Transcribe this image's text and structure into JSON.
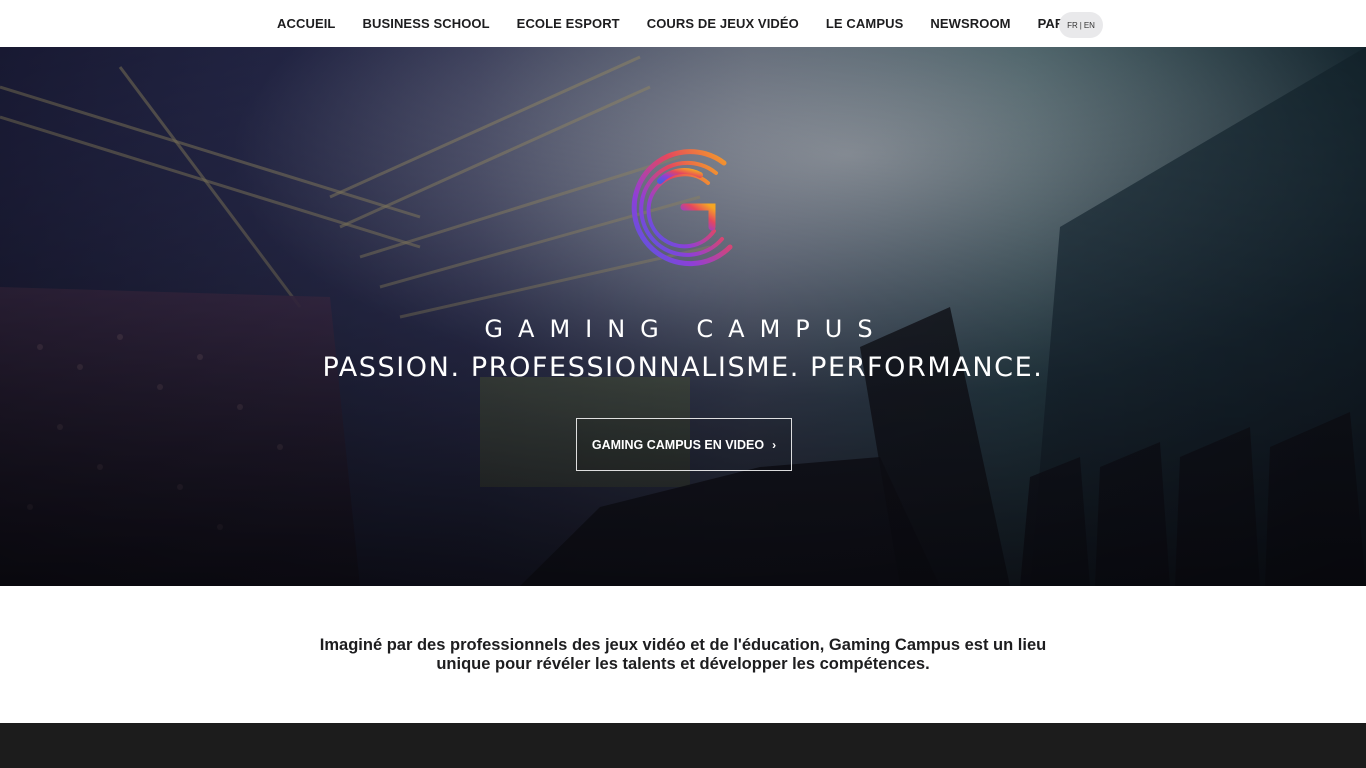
{
  "nav": {
    "items": [
      {
        "label": "ACCUEIL"
      },
      {
        "label": "BUSINESS SCHOOL"
      },
      {
        "label": "ECOLE ESPORT"
      },
      {
        "label": "COURS DE JEUX VIDÉO"
      },
      {
        "label": "LE CAMPUS"
      },
      {
        "label": "NEWSROOM"
      },
      {
        "label": "PARENTS"
      }
    ],
    "lang_fr": "FR",
    "lang_sep": "|",
    "lang_en": "EN"
  },
  "hero": {
    "brand": "GAMING CAMPUS",
    "tagline": "PASSION. PROFESSIONNALISME. PERFORMANCE.",
    "video_button": "GAMING CAMPUS EN VIDEO",
    "video_button_chevron": "›",
    "logo_colors": [
      "#f5a623",
      "#e5475e",
      "#8e3fd8",
      "#4a5ee0"
    ]
  },
  "intro": {
    "text": "Imaginé par des professionnels des jeux vidéo et de l'éducation, Gaming Campus est un lieu unique pour révéler les talents et développer les compétences."
  },
  "colors": {
    "nav_text": "#1d1d1f",
    "dark_band": "#1c1c1c",
    "hero_text": "#ffffff"
  }
}
